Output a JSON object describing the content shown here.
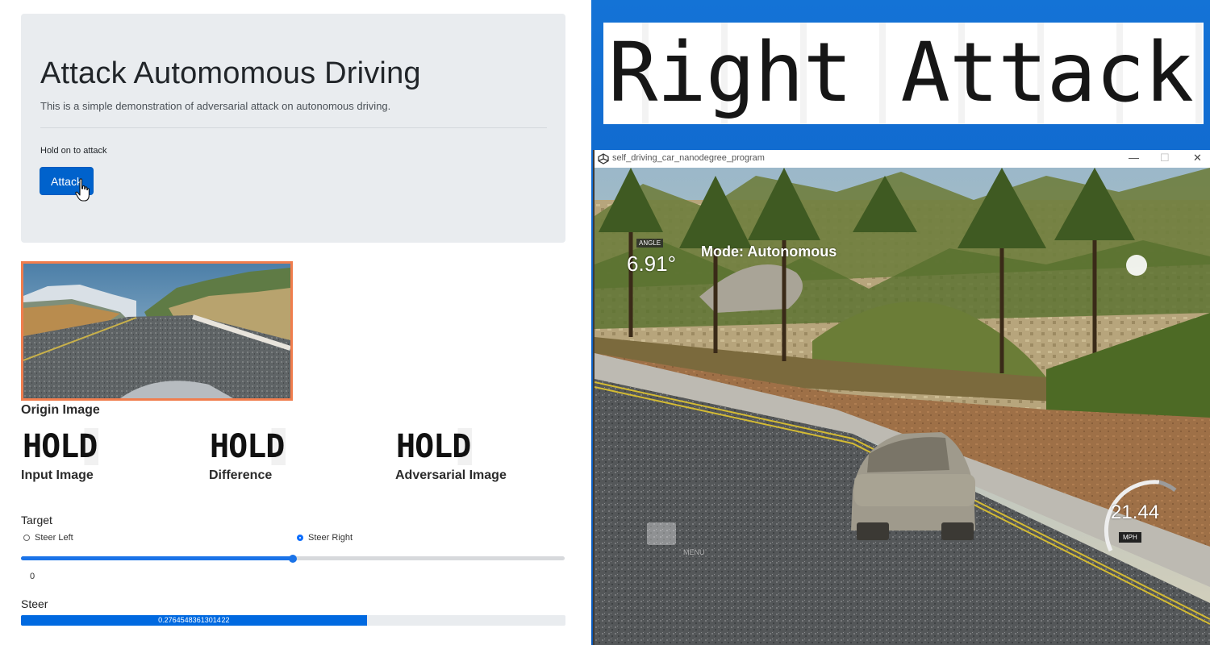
{
  "left_page": {
    "title": "Attack Automomous Driving",
    "subtitle": "This is a simple demonstration of adversarial attack on autonomous driving.",
    "hold_prompt": "Hold on to attack",
    "attack_button": "Attack",
    "origin_caption": "Origin Image",
    "panels": [
      {
        "placeholder": "HOLD",
        "caption": "Input Image"
      },
      {
        "placeholder": "HOLD",
        "caption": "Difference"
      },
      {
        "placeholder": "HOLD",
        "caption": "Adversarial Image"
      }
    ],
    "target": {
      "label": "Target",
      "options": [
        "Steer Left",
        "Steer Right"
      ],
      "selected": "Steer Right"
    },
    "slider": {
      "value_label": "0",
      "fraction": 0.5
    },
    "steer": {
      "label": "Steer",
      "value_text": "0.27645483613014 22",
      "fraction": 0.635
    }
  },
  "banner": {
    "text": "Right Attack"
  },
  "simulator": {
    "window_title": "self_driving_car_nanodegree_program",
    "angle_label": "ANGLE",
    "angle_value": "6.91°",
    "mode_text": "Mode: Autonomous",
    "speed_value": "21.44",
    "speed_unit": "MPH",
    "menu_label": "MENU",
    "window_controls": [
      "—",
      "☐",
      "✕"
    ]
  },
  "colors": {
    "accent": "#0062cc",
    "origin_border": "#f07d4d",
    "desktop_blue": "#1473d6"
  }
}
